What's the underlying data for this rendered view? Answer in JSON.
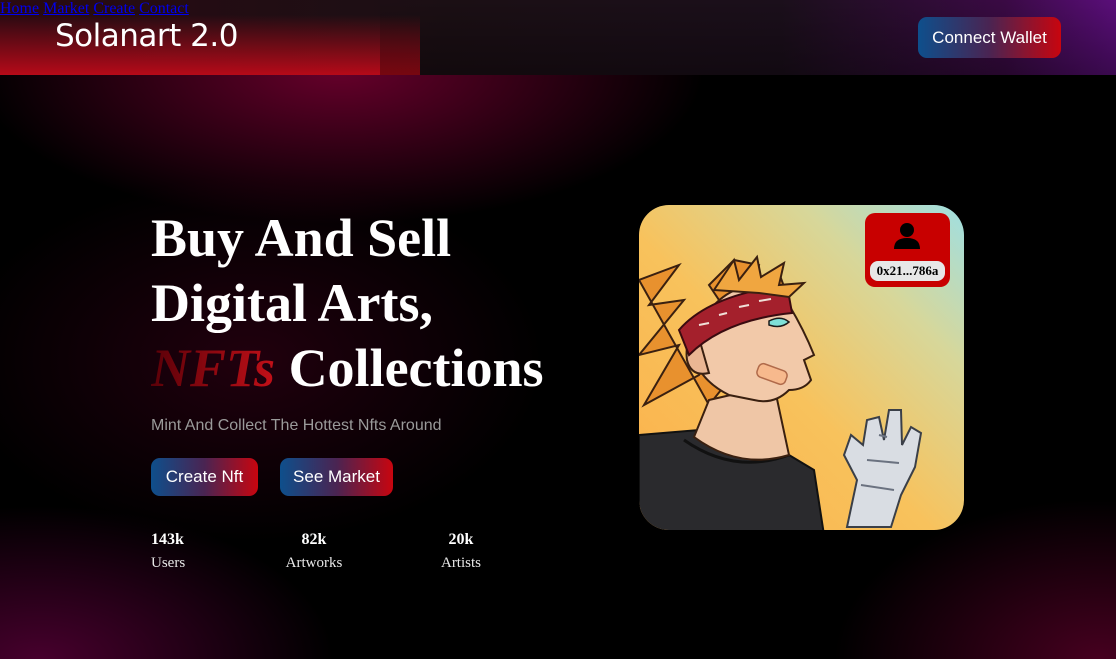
{
  "header": {
    "logo": "Solanart 2.0",
    "nav": [
      "Home",
      "Market",
      "Create",
      "Contact"
    ],
    "connect_label": "Connect Wallet"
  },
  "hero": {
    "headline_line1": "Buy And Sell",
    "headline_line2": "Digital Arts,",
    "headline_accent": "NFTs",
    "headline_line3_rest": " Collections",
    "subtitle": "Mint And Collect The Hottest Nfts Around",
    "buttons": [
      "Create Nft",
      "See Market"
    ],
    "stats": [
      {
        "value": "143k",
        "label": "Users"
      },
      {
        "value": "82k",
        "label": "Artworks"
      },
      {
        "value": "20k",
        "label": "Artists"
      }
    ]
  },
  "card": {
    "owner_address": "0x21...786a",
    "icon": "user-icon",
    "artwork": "anime-character-illustration"
  },
  "colors": {
    "accent_red": "#c8050f",
    "accent_blue": "#0e4f8c",
    "owner_badge": "#c80000"
  }
}
